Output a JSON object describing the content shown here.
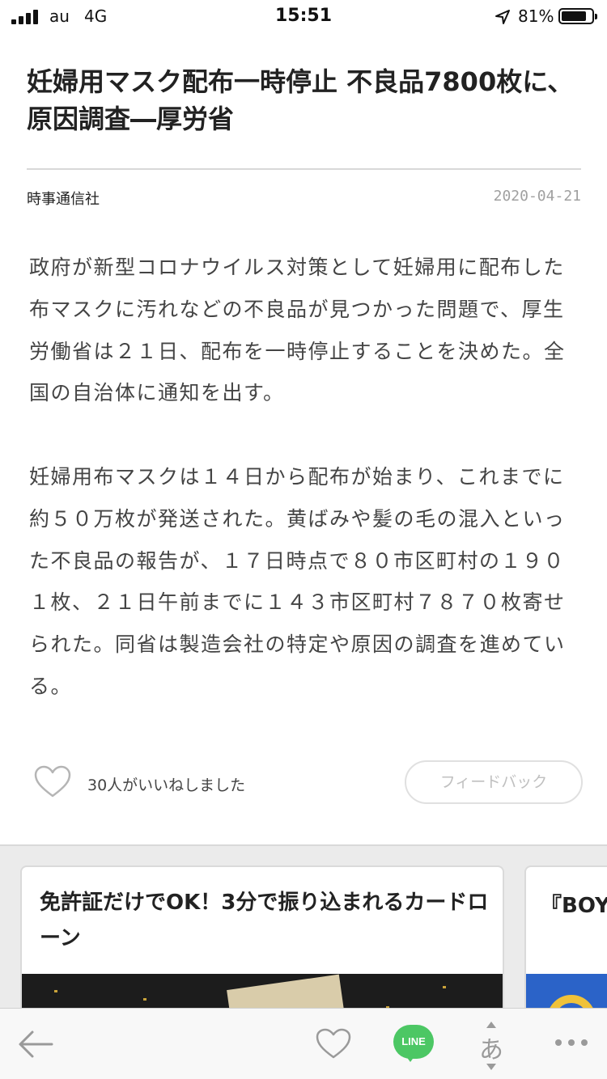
{
  "status_bar": {
    "carrier": "au",
    "network": "4G",
    "time": "15:51",
    "battery": "81%",
    "battery_level": 0.81,
    "signal_bars": 4
  },
  "article": {
    "headline": "妊婦用マスク配布一時停止 不良品7800枚に、原因調査―厚労省",
    "source": "時事通信社",
    "date": "2020-04-21",
    "paragraphs": [
      "政府が新型コロナウイルス対策として妊婦用に配布した布マスクに汚れなどの不良品が見つかった問題で、厚生労働省は２１日、配布を一時停止することを決めた。全国の自治体に通知を出す。",
      "妊婦用布マスクは１４日から配布が始まり、これまでに約５０万枚が発送された。黄ばみや髪の毛の混入といった不良品の報告が、１７日時点で８０市区町村の１９０１枚、２１日午前までに１４３市区町村７８７０枚寄せられた。同省は製造会社の特定や原因の調査を進めている。"
    ]
  },
  "reactions": {
    "like_count_text": "30人がいいねしました",
    "feedback_label": "フィードバック"
  },
  "recommendations": [
    {
      "title": "免許証だけでOK！3分で振り込まれるカードローン"
    },
    {
      "title": "『BOY"
    }
  ],
  "toolbar": {
    "line_label": "LINE",
    "font_glyph": "あ",
    "icons": [
      "back-arrow-icon",
      "heart-icon",
      "line-icon",
      "font-size-icon",
      "more-icon"
    ]
  },
  "colors": {
    "line_green": "#4cc764",
    "date_gray": "#a0a0a0",
    "body_text": "#444444"
  }
}
